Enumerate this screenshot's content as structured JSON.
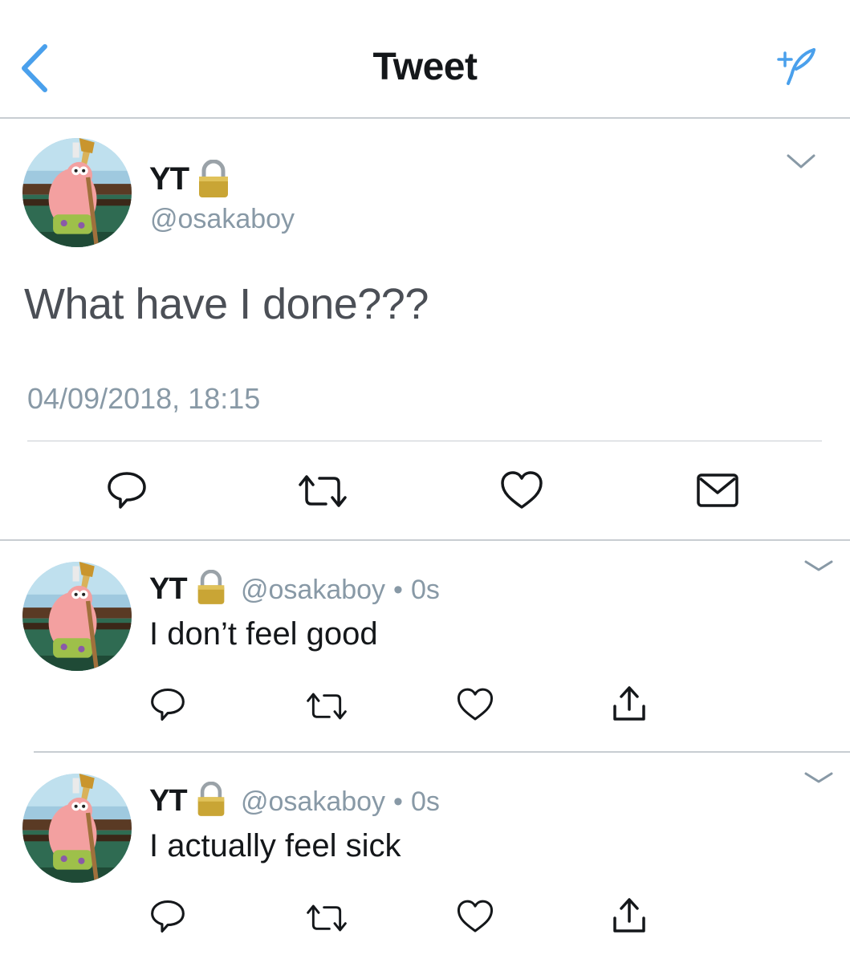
{
  "nav": {
    "title": "Tweet",
    "back_icon": "chevron-left-icon",
    "compose_icon": "compose-tweet-icon"
  },
  "colors": {
    "accent": "#4aa0ec",
    "gray_text": "#8899a6",
    "divider": "#c8cdd2"
  },
  "main_tweet": {
    "name": "YT",
    "protected_icon": "lock-icon",
    "handle": "@osakaboy",
    "text": "What have I done???",
    "timestamp": "04/09/2018, 18:15",
    "actions": [
      "reply-icon",
      "retweet-icon",
      "like-icon",
      "message-icon"
    ]
  },
  "replies": [
    {
      "name": "YT",
      "handle": "@osakaboy",
      "separator": "•",
      "time": "0s",
      "text": "I don’t feel good",
      "actions": [
        "reply-icon",
        "retweet-icon",
        "like-icon",
        "share-icon"
      ]
    },
    {
      "name": "YT",
      "handle": "@osakaboy",
      "separator": "•",
      "time": "0s",
      "text": "I actually feel sick",
      "actions": [
        "reply-icon",
        "retweet-icon",
        "like-icon",
        "share-icon"
      ]
    }
  ]
}
